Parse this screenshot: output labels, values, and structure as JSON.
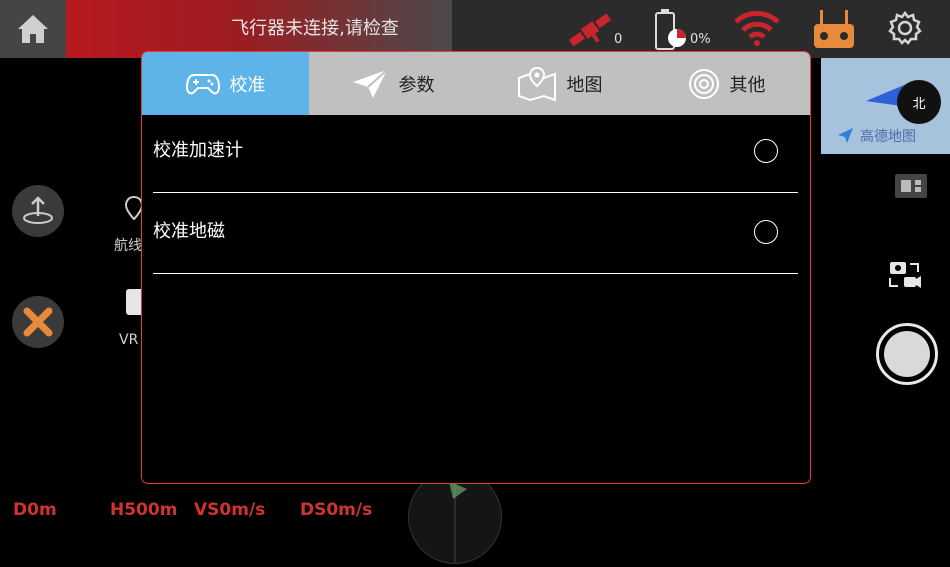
{
  "topbar": {
    "alert_text": "飞行器未连接,请检查",
    "satellite_count": "0",
    "battery_percent": "0%",
    "icons": [
      "home-icon",
      "satellite-icon",
      "battery-icon",
      "wifi-icon",
      "remote-controller-icon",
      "gear-icon"
    ]
  },
  "left_panel": {
    "route_label": "航线",
    "vr_label": "VR"
  },
  "map": {
    "logo_text": "高德地图",
    "compass_label": "北"
  },
  "dialog": {
    "tabs": [
      {
        "label": "校准",
        "icon": "gamepad-icon",
        "active": true
      },
      {
        "label": "参数",
        "icon": "paper-plane-icon",
        "active": false
      },
      {
        "label": "地图",
        "icon": "map-icon",
        "active": false
      },
      {
        "label": "其他",
        "icon": "target-icon",
        "active": false
      }
    ],
    "rows": [
      {
        "label": "校准加速计"
      },
      {
        "label": "校准地磁"
      }
    ]
  },
  "readouts": {
    "distance": "D0m",
    "height": "H500m",
    "vertical_speed": "VS0m/s",
    "horizontal_speed": "DS0m/s"
  },
  "colors": {
    "accent_blue": "#5eb4e8",
    "alert_red": "#d0332f",
    "dialog_border": "#e03c3c",
    "readout_red": "#d0332f",
    "remote_orange": "#e88a3c"
  }
}
